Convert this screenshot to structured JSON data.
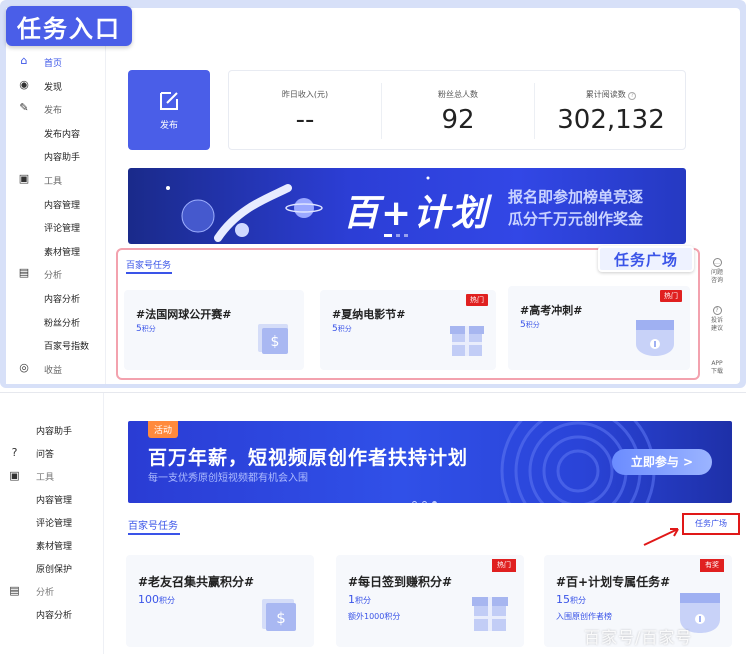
{
  "top": {
    "title_badge": "任务入口",
    "sidebar": {
      "items": [
        {
          "label": "首页",
          "icon": "home-icon",
          "kind": "active"
        },
        {
          "label": "发现",
          "icon": "eye-icon",
          "kind": "main"
        },
        {
          "label": "发布",
          "icon": "edit-icon",
          "kind": "section"
        },
        {
          "label": "发布内容",
          "kind": "sub"
        },
        {
          "label": "内容助手",
          "kind": "sub"
        },
        {
          "label": "工具",
          "icon": "toolbox-icon",
          "kind": "section"
        },
        {
          "label": "内容管理",
          "kind": "sub"
        },
        {
          "label": "评论管理",
          "kind": "sub"
        },
        {
          "label": "素材管理",
          "kind": "sub"
        },
        {
          "label": "分析",
          "icon": "chart-icon",
          "kind": "section"
        },
        {
          "label": "内容分析",
          "kind": "sub"
        },
        {
          "label": "粉丝分析",
          "kind": "sub"
        },
        {
          "label": "百家号指数",
          "kind": "sub"
        },
        {
          "label": "收益",
          "icon": "coin-icon",
          "kind": "section"
        }
      ]
    },
    "publish_button": "发布",
    "kpis": [
      {
        "label": "昨日收入(元)",
        "value": "--"
      },
      {
        "label": "粉丝总人数",
        "value": "92"
      },
      {
        "label": "累计阅读数",
        "value": "302,132"
      }
    ],
    "banner": {
      "headline": "百+计划",
      "line1": "报名即参加榜单竞逐",
      "line2": "瓜分千万元创作奖金"
    },
    "task_section_title": "百家号任务",
    "task_square_badge": "任务广场",
    "tasks": [
      {
        "title": "#法国网球公开赛#",
        "points": "5",
        "unit": "积分",
        "tag": ""
      },
      {
        "title": "#夏纳电影节#",
        "points": "5",
        "unit": "积分",
        "tag": "热门"
      },
      {
        "title": "#高考冲刺#",
        "points": "5",
        "unit": "积分",
        "tag": "热门"
      }
    ],
    "right_rail": [
      {
        "label1": "问题",
        "label2": "咨询"
      },
      {
        "label1": "投诉",
        "label2": "建议"
      },
      {
        "label1": "APP",
        "label2": "下载"
      }
    ]
  },
  "bottom": {
    "sidebar": {
      "items": [
        {
          "label": "内容助手",
          "kind": "sub"
        },
        {
          "label": "问答",
          "icon": "question-icon",
          "kind": "main"
        },
        {
          "label": "工具",
          "icon": "toolbox-icon",
          "kind": "section"
        },
        {
          "label": "内容管理",
          "kind": "sub"
        },
        {
          "label": "评论管理",
          "kind": "sub"
        },
        {
          "label": "素材管理",
          "kind": "sub"
        },
        {
          "label": "原创保护",
          "kind": "sub"
        },
        {
          "label": "分析",
          "icon": "chart-icon",
          "kind": "section"
        },
        {
          "label": "内容分析",
          "kind": "sub"
        }
      ]
    },
    "banner": {
      "tag": "活动",
      "headline": "百万年薪，短视频原创作者扶持计划",
      "subline": "每一支优秀原创短视频都有机会入围",
      "cta": "立即参与 >"
    },
    "task_section_title": "百家号任务",
    "task_square_link": "任务广场",
    "tasks": [
      {
        "title": "#老友召集共赢积分#",
        "points": "100",
        "unit": "积分",
        "extra": "",
        "tag": ""
      },
      {
        "title": "#每日签到赚积分#",
        "points": "1",
        "unit": "积分",
        "extra": "额外1000积分",
        "tag": "热门"
      },
      {
        "title": "#百+计划专属任务#",
        "points": "15",
        "unit": "积分",
        "extra": "入围原创作者榜",
        "tag": "有奖"
      }
    ]
  },
  "watermark": "百家号/百家号",
  "colors": {
    "accent": "#3a54e8",
    "hot_tag": "#e02020",
    "highlight_border": "#e01818"
  }
}
